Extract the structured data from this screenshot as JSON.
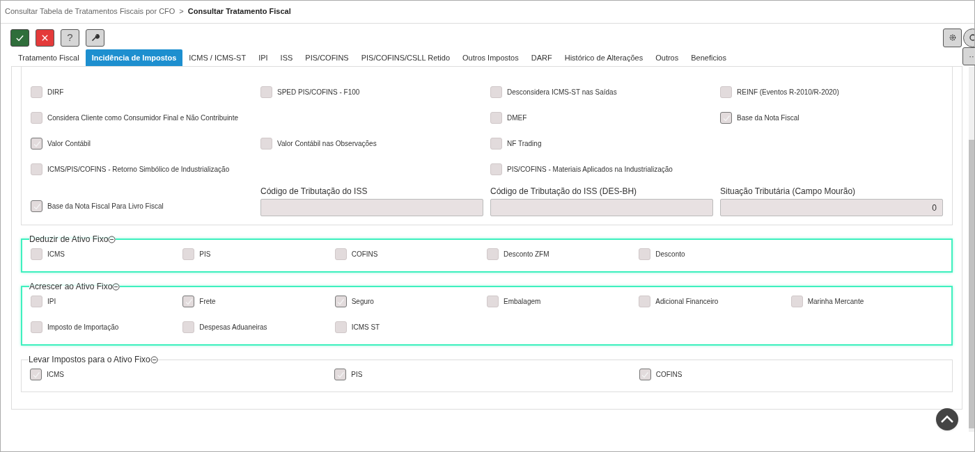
{
  "breadcrumb": {
    "parent": "Consultar Tabela de Tratamentos Fiscais por CFO",
    "separator": ">",
    "current": "Consultar Tratamento Fiscal"
  },
  "more_button": {
    "label": "··"
  },
  "toolbar": [
    {
      "kind": "confirm"
    },
    {
      "kind": "cancel"
    },
    {
      "kind": "help",
      "label": "?"
    },
    {
      "kind": "tools"
    }
  ],
  "tabs": [
    {
      "label": "Tratamento Fiscal",
      "selected": false
    },
    {
      "label": "Incidência de Impostos",
      "selected": true
    },
    {
      "label": "ICMS / ICMS-ST",
      "selected": false
    },
    {
      "label": "IPI",
      "selected": false
    },
    {
      "label": "ISS",
      "selected": false
    },
    {
      "label": "PIS/COFINS",
      "selected": false
    },
    {
      "label": "PIS/COFINS/CSLL Retido",
      "selected": false
    },
    {
      "label": "Outros Impostos",
      "selected": false
    },
    {
      "label": "DARF",
      "selected": false
    },
    {
      "label": "Histórico de Alterações",
      "selected": false
    },
    {
      "label": "Outros",
      "selected": false
    },
    {
      "label": "Beneficios",
      "selected": false
    }
  ],
  "options": [
    [
      {
        "kind": "checkbox",
        "label": "DIRF",
        "checked": false
      },
      {
        "kind": "checkbox",
        "label": "SPED PIS/COFINS - F100",
        "checked": false
      },
      {
        "kind": "checkbox",
        "label": "Desconsidera ICMS-ST nas Saídas",
        "checked": false
      },
      {
        "kind": "checkbox",
        "label": "REINF (Eventos R-2010/R-2020)",
        "checked": false
      }
    ],
    [
      {
        "kind": "checkbox",
        "label": "Considera Cliente como Consumidor Final e Não Contribuinte",
        "checked": false
      },
      {
        "kind": "spacer"
      },
      {
        "kind": "checkbox",
        "label": "DMEF",
        "checked": false
      },
      {
        "kind": "checkbox",
        "label": "Base da Nota Fiscal",
        "checked": true
      }
    ],
    [
      {
        "kind": "checkbox",
        "label": "Valor Contábil",
        "checked": true
      },
      {
        "kind": "checkbox",
        "label": "Valor Contábil nas Observações",
        "checked": false
      },
      {
        "kind": "checkbox",
        "label": "NF Trading",
        "checked": false
      },
      {
        "kind": "spacer"
      }
    ],
    [
      {
        "kind": "checkbox",
        "label": "ICMS/PIS/COFINS - Retorno Simbólico de Industrialização",
        "checked": false
      },
      {
        "kind": "spacer"
      },
      {
        "kind": "checkbox",
        "label": "PIS/COFINS - Materiais Aplicados na Industrialização",
        "checked": false
      },
      {
        "kind": "spacer"
      }
    ]
  ],
  "book_option": {
    "label": "Base da Nota Fiscal Para Livro Fiscal",
    "checked": true
  },
  "fields": [
    {
      "label": "Código de Tributação do ISS"
    },
    {
      "label": "Código de Tributação do ISS (DES-BH)"
    },
    {
      "label": "Situação Tributária (Campo Mourão)",
      "value": "0"
    }
  ],
  "groups": [
    {
      "title": "Deduzir de Ativo Fixo",
      "highlighted": true,
      "items": [
        {
          "label": "ICMS",
          "checked": false
        },
        {
          "label": "PIS",
          "checked": false
        },
        {
          "label": "COFINS",
          "checked": false
        },
        {
          "label": "Desconto ZFM",
          "checked": false
        },
        {
          "label": "Desconto",
          "checked": false
        }
      ]
    },
    {
      "title": "Acrescer ao Ativo Fixo",
      "highlighted": true,
      "items": [
        {
          "label": "IPI",
          "checked": false
        },
        {
          "label": "Frete",
          "checked": true
        },
        {
          "label": "Seguro",
          "checked": true
        },
        {
          "label": "Embalagem",
          "checked": false
        },
        {
          "label": "Adicional Financeiro",
          "checked": false
        },
        {
          "label": "Marinha Mercante",
          "checked": false
        },
        {
          "label": "Imposto de Importação",
          "checked": false
        },
        {
          "label": "Despesas Aduaneiras",
          "checked": false
        },
        {
          "label": "ICMS ST",
          "checked": false
        }
      ]
    },
    {
      "title": "Levar Impostos para o Ativo Fixo",
      "highlighted": false,
      "items": [
        {
          "label": "ICMS",
          "checked": true
        },
        {
          "label": "PIS",
          "checked": true
        },
        {
          "label": "COFINS",
          "checked": true
        }
      ]
    }
  ]
}
